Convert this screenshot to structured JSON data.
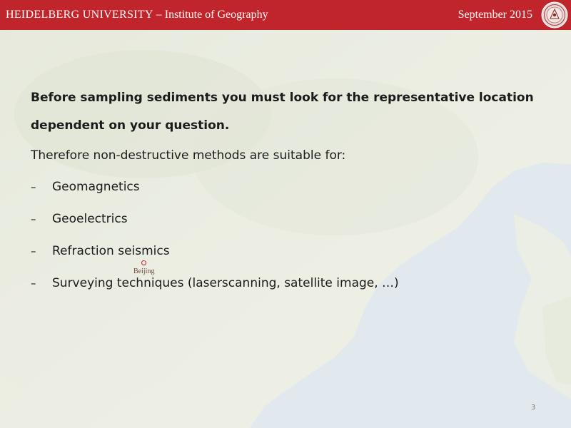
{
  "header": {
    "university": "HEIDELBERG UNIVERSITY",
    "institute": " – Institute of Geography",
    "date": "September 2015",
    "logo_icon": "university-seal-icon",
    "background_color": "#c0252b"
  },
  "content": {
    "lead": "Before sampling sediments you must look for the representative location dependent on your question.",
    "intro": "Therefore non-destructive methods are suitable for:",
    "bullet_marker": "–",
    "bullets": [
      "Geomagnetics",
      "Geoelectrics",
      "Refraction seismics",
      "Surveying techniques (laserscanning, satellite image, …)"
    ]
  },
  "map": {
    "city_label": "Beijing",
    "marker_color": "#c0252b"
  },
  "footer": {
    "page_number": "3"
  }
}
